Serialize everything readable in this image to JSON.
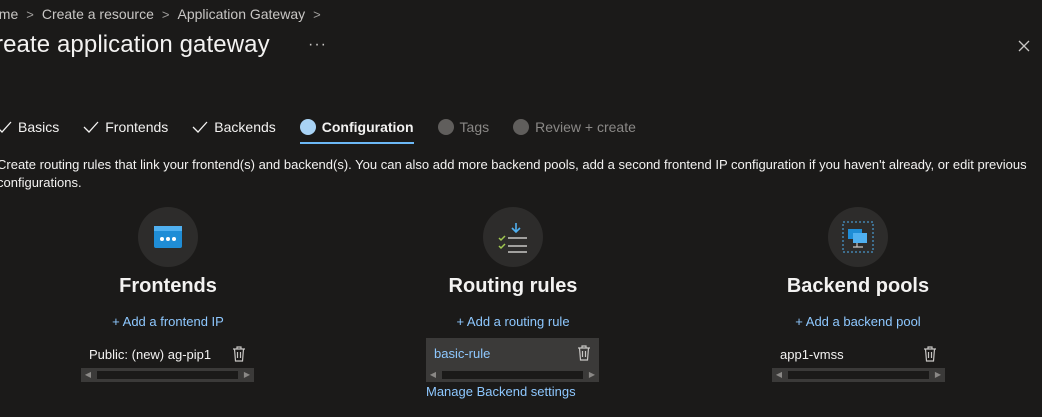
{
  "breadcrumb": {
    "items": [
      "ome",
      "Create a resource",
      "Application Gateway"
    ]
  },
  "page": {
    "title": "reate application gateway",
    "more_label": "···"
  },
  "steps": [
    {
      "label": "Basics",
      "state": "done"
    },
    {
      "label": "Frontends",
      "state": "done"
    },
    {
      "label": "Backends",
      "state": "done"
    },
    {
      "label": "Configuration",
      "state": "active"
    },
    {
      "label": "Tags",
      "state": "disabled"
    },
    {
      "label": "Review + create",
      "state": "disabled"
    }
  ],
  "description": "Create routing rules that link your frontend(s) and backend(s). You can also add more backend pools, add a second frontend IP configuration if you haven't already, or edit previous configurations.",
  "frontends": {
    "heading": "Frontends",
    "add_label": "+ Add a frontend IP",
    "items": [
      "Public: (new) ag-pip1"
    ]
  },
  "routing": {
    "heading": "Routing rules",
    "add_label": "+ Add a routing rule",
    "items": [
      "basic-rule"
    ],
    "manage_label": "Manage Backend settings"
  },
  "backends": {
    "heading": "Backend pools",
    "add_label": "+ Add a backend pool",
    "items": [
      "app1-vmss"
    ]
  },
  "colors": {
    "accent": "#6cb8f6",
    "link": "#8ec8ff",
    "background": "#1b1a19"
  }
}
